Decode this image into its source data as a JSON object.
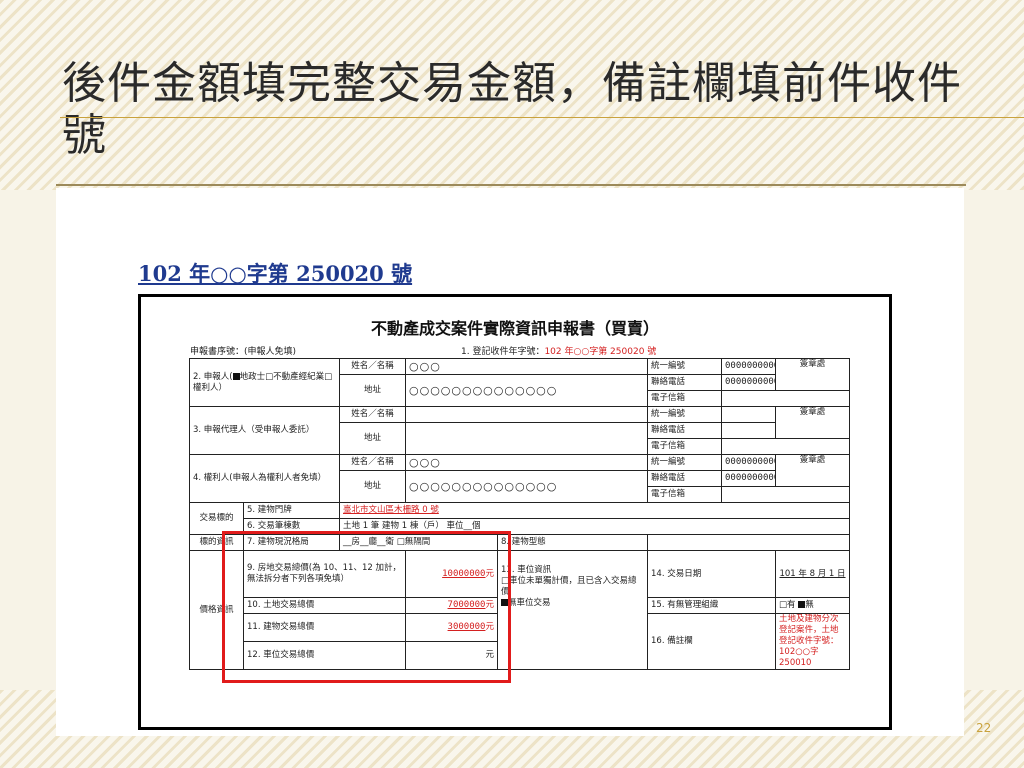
{
  "slide": {
    "title": "後件金額填完整交易金額，備註欄填前件收件號",
    "page_number": "22"
  },
  "document": {
    "case_number": "102 年○○字第 250020 號",
    "form_title": "不動產成交案件實際資訊申報書（買賣）",
    "serial_label": "申報書序號：(申報人免填)",
    "registration_label": "1. 登記收件年字號：",
    "registration_value": "102 年○○字第 250020 號",
    "common": {
      "name_label": "姓名／名稱",
      "address_label": "地址",
      "id_label": "統一編號",
      "phone_label": "聯絡電話",
      "email_label": "電子信箱",
      "sign_label": "簽章處"
    },
    "applicant": {
      "label_prefix": "2. 申報人(",
      "label_suffix": "地政士□不動產經紀業□權利人）",
      "name": "○○○",
      "address": "○○○○○○○○○○○○○○",
      "id": "0000000000",
      "phone": "0000000000"
    },
    "agent": {
      "label": "3. 申報代理人（受申報人委託）"
    },
    "right_holder": {
      "label": "4. 權利人(申報人為權利人者免填）",
      "name": "○○○",
      "address": "○○○○○○○○○○○○○○",
      "id": "0000000000",
      "phone": "0000000000"
    },
    "transaction": {
      "section_label": "交易標的",
      "door_label": "5. 建物門牌",
      "door_value": "臺北市文山區木柵路 0 號",
      "count_label": "6. 交易筆棟數",
      "count_value": "土地 1 筆   建物 1 棟（戶）  車位__個",
      "status_section": "標的資訊",
      "layout_label": "7. 建物現況格局",
      "layout_value": "__房__廳__衛  □無隔間",
      "type_label": "8. 建物型態"
    },
    "price": {
      "section_label": "價格資訊",
      "total_label": "9. 房地交易總價(為 10、11、12 加計，無法拆分者下列各項免填）",
      "total_value": "10000000",
      "land_label": "10. 土地交易總價",
      "land_value": "7000000",
      "building_label": "11. 建物交易總價",
      "building_value": "3000000",
      "parking_label": "12. 車位交易總價",
      "currency": "元",
      "parking_info_label": "13. 車位資訊",
      "parking_option1": "□車位未單獨計價，且已含入交易總價",
      "parking_option2": "無車位交易",
      "date_label": "14. 交易日期",
      "date_value": "101 年 8 月 1 日",
      "mgmt_label": "15. 有無管理組織",
      "mgmt_value": "□有",
      "mgmt_value2": "無",
      "remark_label": "16. 備註欄",
      "remark_value": "土地及建物分次登記案件，土地登記收件字號：102○○字 250010"
    }
  }
}
